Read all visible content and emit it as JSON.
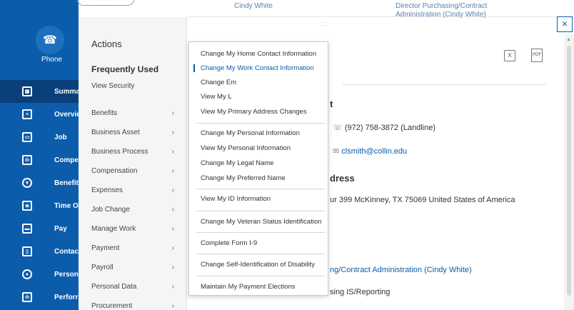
{
  "header": {
    "actions_pill": "Actions",
    "top_left_text": "Cindy White",
    "top_right_text": "Director Purchasing/Contract Administration (Cindy White)"
  },
  "phone": {
    "label": "Phone"
  },
  "nav": {
    "items": [
      {
        "label": "Summa",
        "icon": "summary-icon"
      },
      {
        "label": "Overvie",
        "icon": "overview-icon"
      },
      {
        "label": "Job",
        "icon": "job-icon"
      },
      {
        "label": "Compe",
        "icon": "compensation-icon"
      },
      {
        "label": "Benefit",
        "icon": "benefits-icon"
      },
      {
        "label": "Time O",
        "icon": "time-off-icon"
      },
      {
        "label": "Pay",
        "icon": "pay-icon"
      },
      {
        "label": "Contac",
        "icon": "contact-icon"
      },
      {
        "label": "Person",
        "icon": "person-icon"
      },
      {
        "label": "Perforr",
        "icon": "performance-icon"
      }
    ]
  },
  "actions": {
    "title": "Actions",
    "frequently_used": "Frequently Used",
    "view_security": "View Security",
    "categories": [
      "Benefits",
      "Business Asset",
      "Business Process",
      "Compensation",
      "Expenses",
      "Job Change",
      "Manage Work",
      "Payment",
      "Payroll",
      "Personal Data",
      "Procurement"
    ]
  },
  "submenu": {
    "items": [
      "Change My Home Contact Information",
      "Change My Work Contact Information",
      "Change Em",
      "View My L",
      "View My Primary Address Changes",
      "Change My Personal Information",
      "View My Personal Information",
      "Change My Legal Name",
      "Change My Preferred Name",
      "View My ID Information",
      "Change My Veteran Status Identification",
      "Complete Form I-9",
      "Change Self-Identification of Disability",
      "Maintain My Payment Elections"
    ]
  },
  "page": {
    "section_contact_head": "t",
    "phone_value": "(972) 758-3872 (Landline)",
    "email_value": "clsmith@collin.edu",
    "address_head": "dress",
    "address_value": "ur 399 McKinney, TX 75069 United States of America",
    "manager_value": "ng/Contract Administration (Cindy White)",
    "org_value": "sing IS/Reporting"
  },
  "controls": {
    "grip": ":::",
    "close": "×",
    "pdf": "PDF",
    "excel": "X"
  }
}
